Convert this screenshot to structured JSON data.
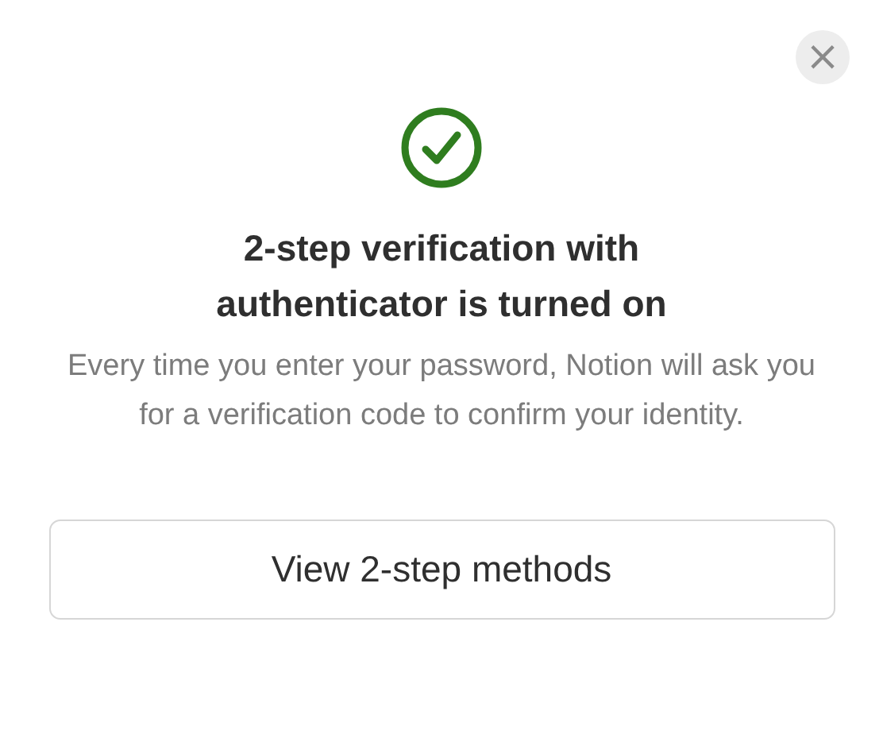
{
  "dialog": {
    "close_label": "×",
    "title": "2-step verification with authenticator is turned on",
    "description": "Every time you enter your password, Notion will ask you for a verification code to confirm your identity.",
    "button": "View 2-step methods"
  }
}
